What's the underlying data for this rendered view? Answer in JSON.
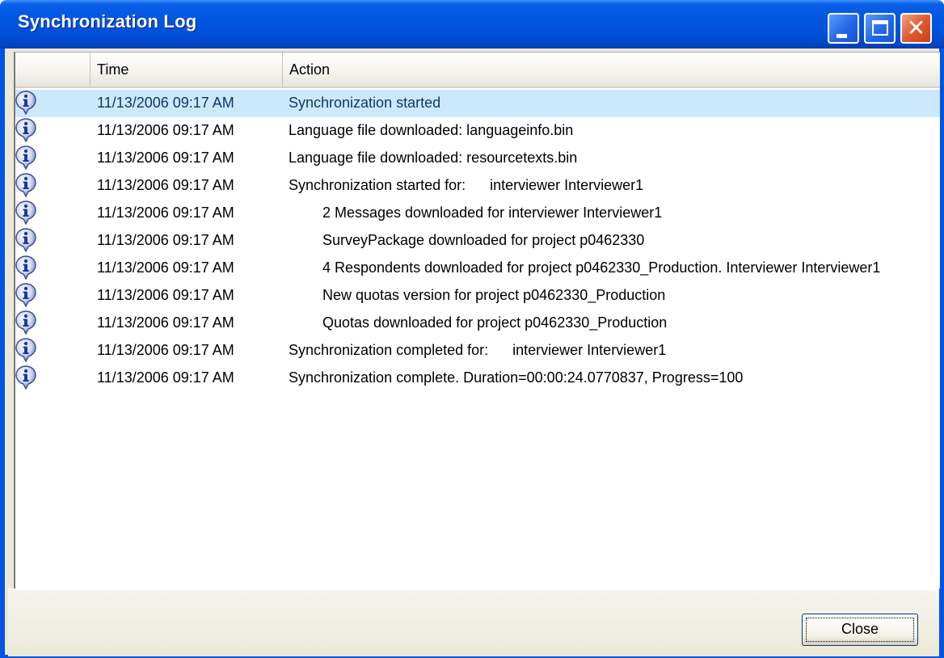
{
  "window": {
    "title": "Synchronization Log"
  },
  "listview": {
    "columns": [
      "",
      "Time",
      "Action"
    ],
    "rows": [
      {
        "time": "11/13/2006 09:17 AM",
        "action": "Synchronization started",
        "selected": true,
        "indent": 0
      },
      {
        "time": "11/13/2006 09:17 AM",
        "action": "Language file downloaded: languageinfo.bin",
        "indent": 0
      },
      {
        "time": "11/13/2006 09:17 AM",
        "action": "Language file downloaded: resourcetexts.bin",
        "indent": 0
      },
      {
        "time": "11/13/2006 09:17 AM",
        "action": "Synchronization started for:      interviewer Interviewer1",
        "indent": 0
      },
      {
        "time": "11/13/2006 09:17 AM",
        "action": "2 Messages downloaded for interviewer Interviewer1",
        "indent": 1
      },
      {
        "time": "11/13/2006 09:17 AM",
        "action": "SurveyPackage downloaded for project p0462330",
        "indent": 1
      },
      {
        "time": "11/13/2006 09:17 AM",
        "action": "4 Respondents downloaded for project p0462330_Production. Interviewer Interviewer1",
        "indent": 1
      },
      {
        "time": "11/13/2006 09:17 AM",
        "action": "New quotas version for project p0462330_Production",
        "indent": 1
      },
      {
        "time": "11/13/2006 09:17 AM",
        "action": "Quotas downloaded for project p0462330_Production",
        "indent": 1
      },
      {
        "time": "11/13/2006 09:17 AM",
        "action": "Synchronization completed for:      interviewer Interviewer1",
        "indent": 0
      },
      {
        "time": "11/13/2006 09:17 AM",
        "action": "Synchronization complete. Duration=00:00:24.0770837, Progress=100",
        "indent": 0
      }
    ],
    "row_icon": "info-icon"
  },
  "footer": {
    "close_label": "Close"
  },
  "colors": {
    "titlebar": "#0054e3",
    "selected_row": "#cce8fb",
    "dialog_face": "#ece9d8"
  }
}
